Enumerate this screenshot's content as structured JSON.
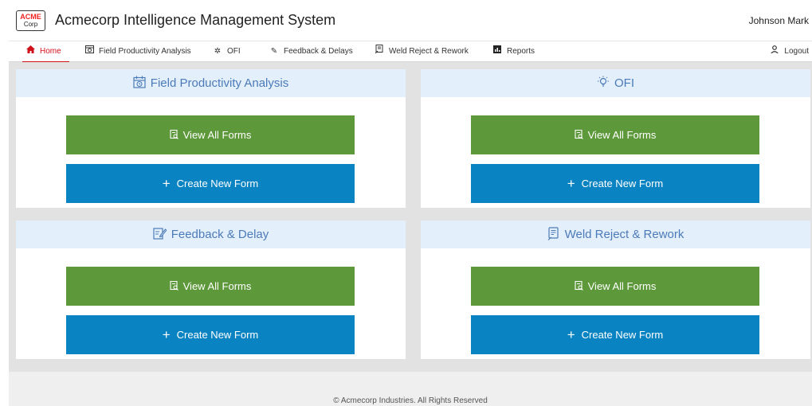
{
  "header": {
    "logo_top": "ACME",
    "logo_bottom": "Corp",
    "title": "Acmecorp Intelligence Management System",
    "user_name": "Johnson Mark"
  },
  "nav": {
    "items": [
      {
        "label": "Home",
        "icon": "home-icon"
      },
      {
        "label": "Field Productivity Analysis",
        "icon": "calendar-clock-icon"
      },
      {
        "label": "OFI",
        "icon": "lightbulb-icon"
      },
      {
        "label": "Feedback & Delays",
        "icon": "edit-note-icon"
      },
      {
        "label": "Weld Reject & Rework",
        "icon": "document-search-icon"
      },
      {
        "label": "Reports",
        "icon": "chart-icon"
      }
    ],
    "logout_label": "Logout",
    "active_index": 0
  },
  "cards": [
    {
      "title": "Field Productivity Analysis",
      "icon": "calendar-clock-icon",
      "view_label": "View All Forms",
      "create_label": "Create New Form"
    },
    {
      "title": "OFI",
      "icon": "lightbulb-icon",
      "view_label": "View All Forms",
      "create_label": "Create New Form"
    },
    {
      "title": "Feedback & Delay",
      "icon": "edit-note-icon",
      "view_label": "View All Forms",
      "create_label": "Create New Form"
    },
    {
      "title": "Weld Reject & Rework",
      "icon": "document-search-icon",
      "view_label": "View All Forms",
      "create_label": "Create New Form"
    }
  ],
  "footer": {
    "text": "© Acmecorp Industries. All Rights Reserved"
  },
  "colors": {
    "accent_red": "#d0111b",
    "view_green": "#5d993a",
    "create_blue": "#0a83c2",
    "card_header_bg": "#e3f0fb",
    "card_header_text": "#4c7ab8"
  }
}
